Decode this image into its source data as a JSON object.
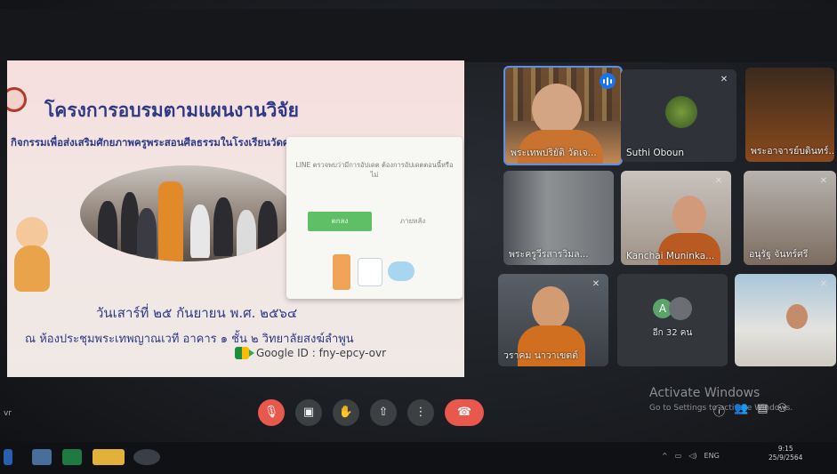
{
  "window": {
    "title_fragment": ""
  },
  "slide": {
    "title": "โครงการอบรมตามแผนงานวิจัย",
    "subtitle": "กิจกรรมเพื่อส่งเสริมศักยภาพครูพระสอนศีลธรรมในโรงเรียนวัดศรีสวัสดิ์",
    "date": "วันเสาร์ที่ ๒๕ กันยายน พ.ศ. ๒๕๖๔",
    "place": "ณ ห้องประชุมพระเทพญาณเวที อาคาร ๑ ชั้น ๒ วิทยาลัยสงฆ์ลำพูน",
    "meet_id": "Google ID : fny-epcy-ovr"
  },
  "line_popup": {
    "message": "LINE ตรวจพบว่ามีการอัปเดต ต้องการอัปเดตตอนนี้หรือไม่",
    "sub": "",
    "ok_label": "ตกลง",
    "later_label": "ภายหลัง"
  },
  "participants": [
    {
      "name": "พระเทพปริยัติ วัดเจ...",
      "speaking": true,
      "muted": false
    },
    {
      "name": "Suthi Oboun",
      "speaking": false,
      "muted": true
    },
    {
      "name": "พระอาจารย์บดินทร์...",
      "speaking": false,
      "muted": false
    },
    {
      "name": "พระครูวีรสารวิมล...",
      "speaking": false,
      "muted": false
    },
    {
      "name": "Kanchai Muninka...",
      "speaking": false,
      "muted": true
    },
    {
      "name": "อนุรัฐ จันทร์ศรี",
      "speaking": false,
      "muted": true
    },
    {
      "name": "วราคม นาวาเขตต์",
      "speaking": false,
      "muted": true
    },
    {
      "name": "อีก 32 คน",
      "speaking": false,
      "muted": false
    },
    {
      "name": "",
      "speaking": false,
      "muted": true
    }
  ],
  "overflow_avatar_letter": "A",
  "controls": {
    "mic": "🎙",
    "camera": "▣",
    "raise_hand": "✋",
    "present": "⇧",
    "more": "⋮",
    "hangup": "☎"
  },
  "watermark": {
    "line1": "Activate Windows",
    "line2": "Go to Settings to activate Windows."
  },
  "right_controls": {
    "info": "ⓘ",
    "people": "👥",
    "chat": "▤",
    "activities": "⚇"
  },
  "taskbar": {
    "lang": "ENG",
    "time": "9:15",
    "date": "25/9/2564"
  },
  "bottom_left_fragment": "vr"
}
